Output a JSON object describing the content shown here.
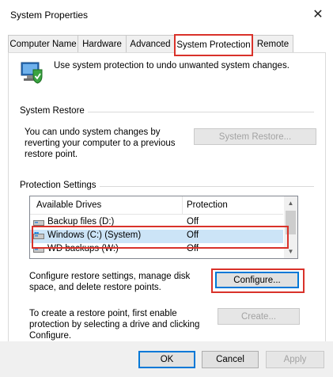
{
  "window": {
    "title": "System Properties",
    "close_glyph": "✕"
  },
  "tabs": [
    {
      "label": "Computer Name"
    },
    {
      "label": "Hardware"
    },
    {
      "label": "Advanced"
    },
    {
      "label": "System Protection"
    },
    {
      "label": "Remote"
    }
  ],
  "header": {
    "text": "Use system protection to undo unwanted system changes.",
    "icon": "system-protection-icon"
  },
  "system_restore": {
    "group_label": "System Restore",
    "description": "You can undo system changes by reverting your computer to a previous restore point.",
    "button": "System Restore..."
  },
  "protection": {
    "group_label": "Protection Settings",
    "columns": [
      "Available Drives",
      "Protection"
    ],
    "drives": [
      {
        "name": "Backup files (D:)",
        "protection": "Off"
      },
      {
        "name": "Windows (C:) (System)",
        "protection": "Off"
      },
      {
        "name": "WD backups (W:)",
        "protection": "Off"
      }
    ],
    "configure_text": "Configure restore settings, manage disk space, and delete restore points.",
    "configure_button": "Configure...",
    "create_text": "To create a restore point, first enable protection by selecting a drive and clicking Configure.",
    "create_button": "Create..."
  },
  "footer": {
    "ok": "OK",
    "cancel": "Cancel",
    "apply": "Apply"
  },
  "colors": {
    "highlight_red": "#d9322a",
    "selection": "#cce4f7",
    "focus_blue": "#0078d7"
  }
}
